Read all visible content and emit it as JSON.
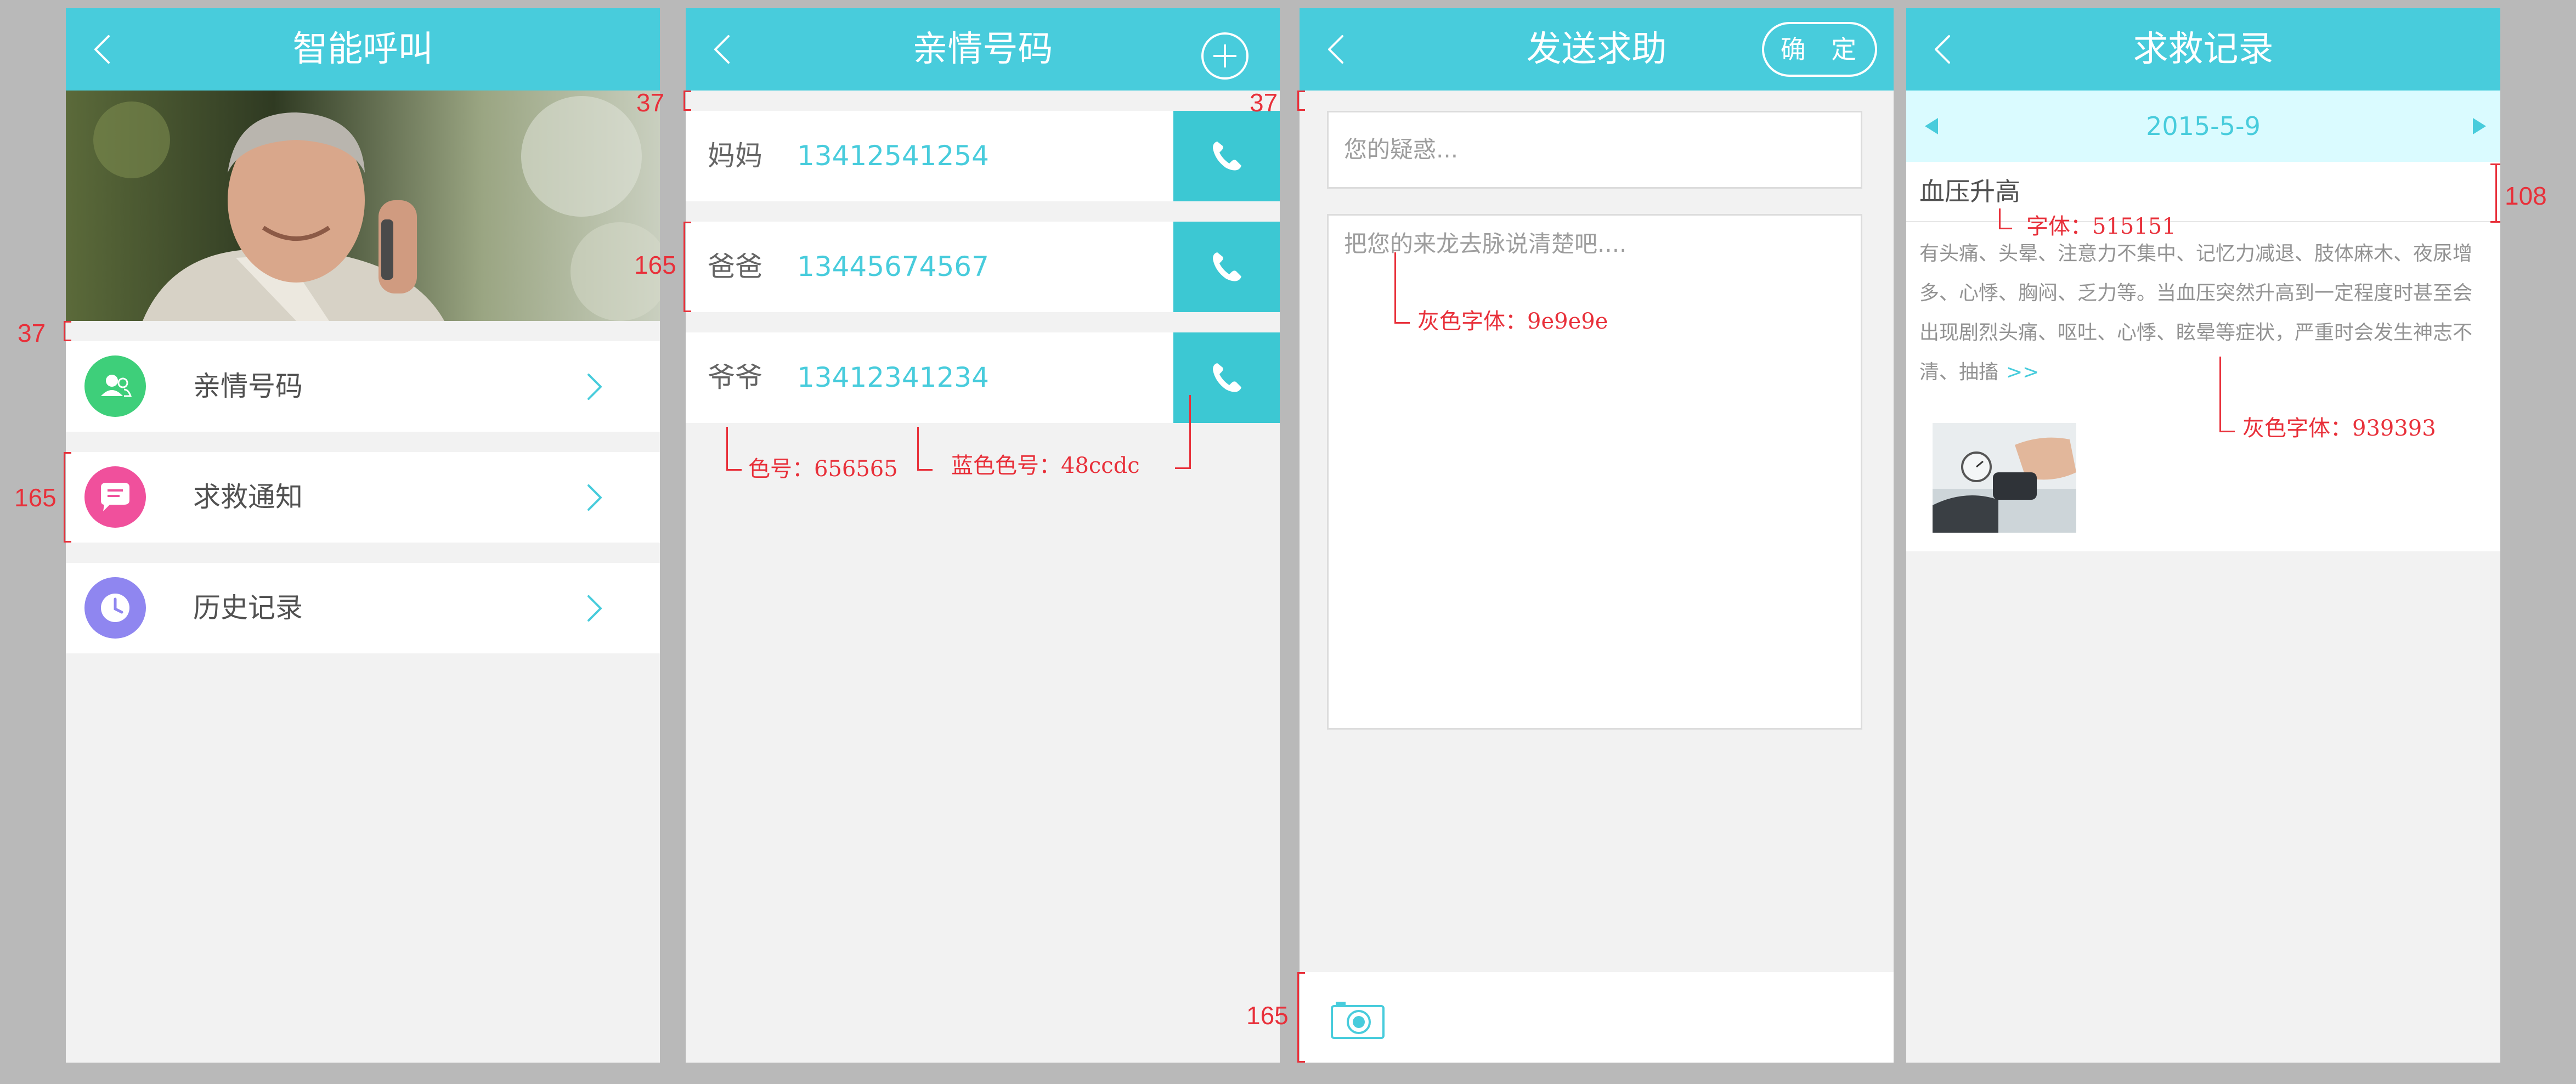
{
  "colors": {
    "accent": "#48ccdc",
    "nav_bg": "#48ccdc",
    "text_dark": "#515151",
    "text_contact": "#656565",
    "placeholder_gray": "#9e9e9e",
    "body_gray": "#939393",
    "annotation_red": "#e8303a",
    "menu_icon_contacts": "#3ecf7a",
    "menu_icon_notice": "#f0509c",
    "menu_icon_history": "#8f86f0"
  },
  "screen1": {
    "title": "智能呼叫",
    "menu": [
      {
        "label": "亲情号码",
        "icon": "contacts-icon"
      },
      {
        "label": "求救通知",
        "icon": "message-icon"
      },
      {
        "label": "历史记录",
        "icon": "clock-icon"
      }
    ]
  },
  "screen2": {
    "title": "亲情号码",
    "contacts": [
      {
        "name": "妈妈",
        "phone": "13412541254"
      },
      {
        "name": "爸爸",
        "phone": "13445674567"
      },
      {
        "name": "爷爷",
        "phone": "13412341234"
      }
    ]
  },
  "screen3": {
    "title": "发送求助",
    "confirm_label": "确 定",
    "subject_placeholder": "您的疑惑...",
    "detail_placeholder": "把您的来龙去脉说清楚吧...."
  },
  "screen4": {
    "title": "求救记录",
    "date": "2015-5-9",
    "record_title": "血压升高",
    "record_body": "有头痛、头晕、注意力不集中、记忆力减退、肢体麻木、夜尿增多、心悸、胸闷、乏力等。当血压突然升高到一定程度时甚至会出现剧烈头痛、呕吐、心悸、眩晕等症状，严重时会发生神志不清、抽搐",
    "more_label": ">>"
  },
  "annotations": {
    "s1_gap": "37",
    "s1_row_height": "165",
    "s2_gap": "37",
    "s2_row_height": "165",
    "s2_color_name": "色号：656565",
    "s2_color_phone": "蓝色色号：48ccdc",
    "s3_gap": "37",
    "s3_gray_font": "灰色字体：9e9e9e",
    "s3_bar_height": "165",
    "s4_title_height": "108",
    "s4_title_font": "字体：515151",
    "s4_gray_font": "灰色字体：939393"
  }
}
